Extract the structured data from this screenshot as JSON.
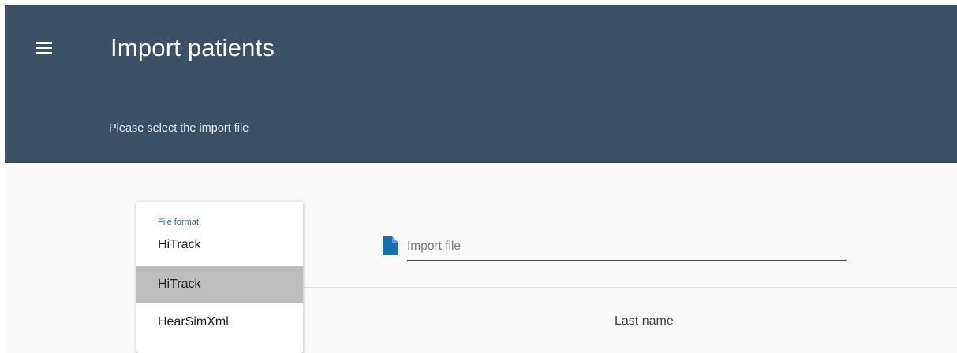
{
  "header": {
    "title": "Import patients",
    "subtitle": "Please select the import file",
    "background_color": "#3d5166"
  },
  "file_format": {
    "label": "File format",
    "selected": "HiTrack",
    "options": [
      "HiTrack",
      "HearSimXml"
    ],
    "highlighted_option": "HiTrack"
  },
  "import_file": {
    "placeholder": "Import file",
    "icon": "file-icon",
    "icon_color": "#1a6eb0"
  },
  "table": {
    "columns": [
      "Last name"
    ]
  }
}
